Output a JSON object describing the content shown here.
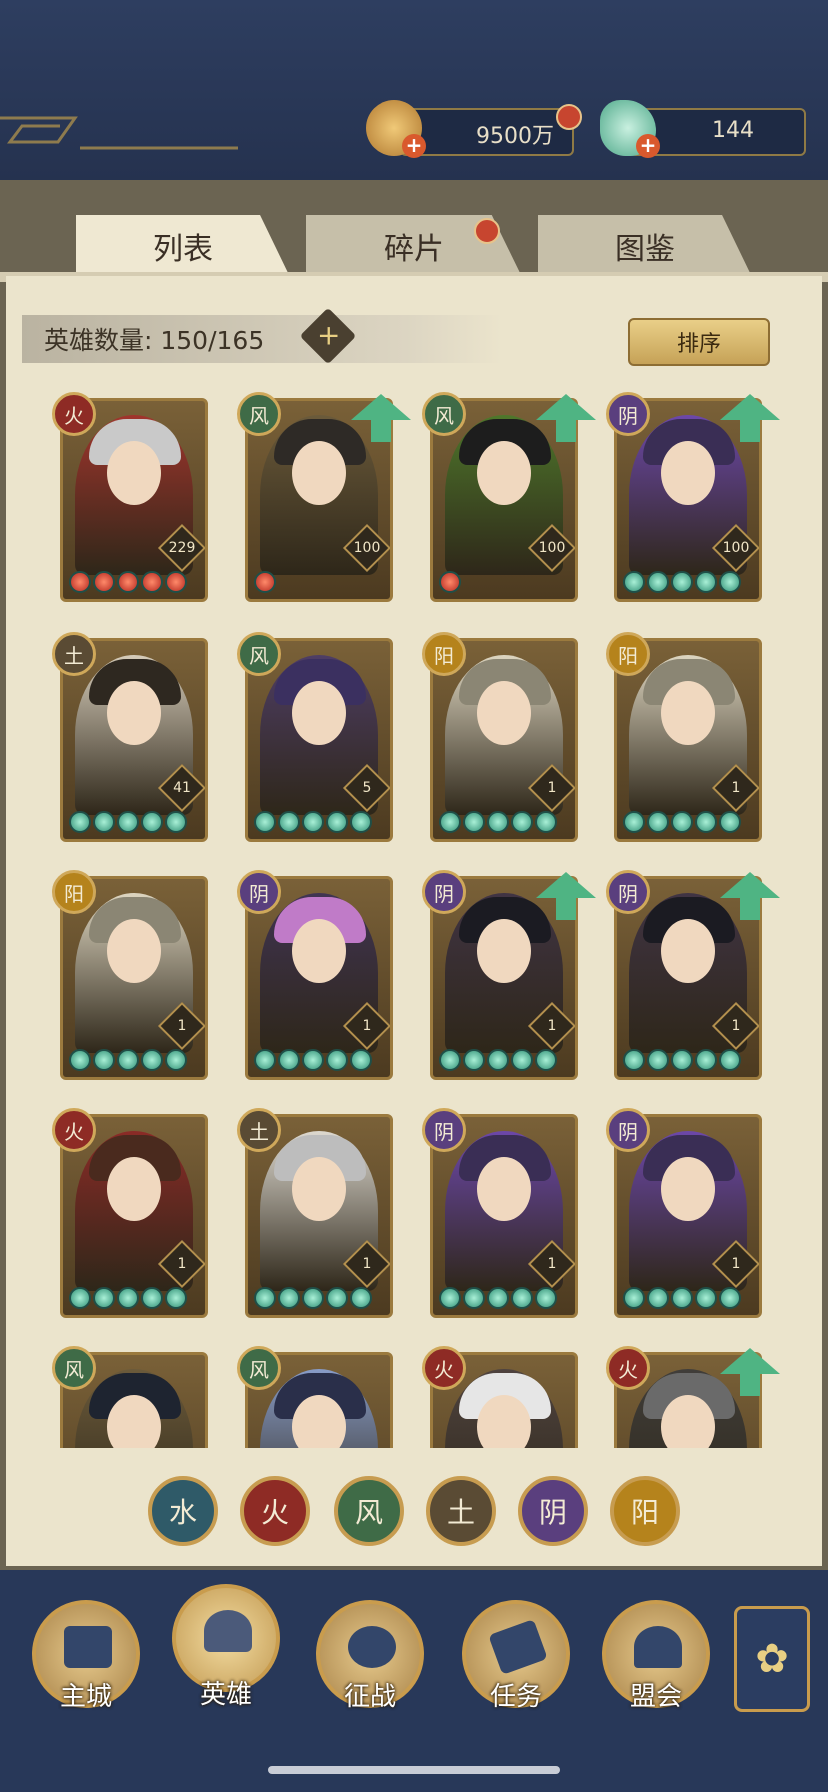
{
  "resources": {
    "copper": {
      "value": "9500万"
    },
    "jade": {
      "value": "144"
    }
  },
  "tabs": [
    {
      "label": "列表"
    },
    {
      "label": "碎片"
    },
    {
      "label": "图鉴"
    }
  ],
  "hero_count": {
    "label": "英雄数量: 150/165"
  },
  "sort_label": "排序",
  "cards": [
    {
      "element": "火",
      "level": "229",
      "stars": 5,
      "upgrade": false,
      "hair": "#c9c9c9",
      "tone": "#a5302b"
    },
    {
      "element": "风",
      "level": "100",
      "stars": 1,
      "upgrade": true,
      "hair": "#2e2a26",
      "tone": "#6a5a3b"
    },
    {
      "element": "风",
      "level": "100",
      "stars": 1,
      "upgrade": true,
      "hair": "#1d1d1d",
      "tone": "#4a7a2a"
    },
    {
      "element": "阴",
      "level": "100",
      "stars": 5,
      "upgrade": true,
      "hair": "#3a2e55",
      "tone": "#6b45b6"
    },
    {
      "element": "土",
      "level": "41",
      "stars": 5,
      "upgrade": false,
      "hair": "#2e2820",
      "tone": "#e0d8c8"
    },
    {
      "element": "风",
      "level": "5",
      "stars": 5,
      "upgrade": false,
      "hair": "#3b3060",
      "tone": "#4a3a6a"
    },
    {
      "element": "阳",
      "level": "1",
      "stars": 5,
      "upgrade": false,
      "hair": "#8b8674",
      "tone": "#e8e2cf"
    },
    {
      "element": "阳",
      "level": "1",
      "stars": 5,
      "upgrade": false,
      "hair": "#8b8674",
      "tone": "#e8e2cf"
    },
    {
      "element": "阳",
      "level": "1",
      "stars": 5,
      "upgrade": false,
      "hair": "#8b8674",
      "tone": "#e8e2cf"
    },
    {
      "element": "阴",
      "level": "1",
      "stars": 5,
      "upgrade": false,
      "hair": "#c07bc8",
      "tone": "#3a2f55"
    },
    {
      "element": "阴",
      "level": "1",
      "stars": 5,
      "upgrade": true,
      "hair": "#1b1b22",
      "tone": "#3a2f45"
    },
    {
      "element": "阴",
      "level": "1",
      "stars": 5,
      "upgrade": true,
      "hair": "#1b1b22",
      "tone": "#3a2f45"
    },
    {
      "element": "火",
      "level": "1",
      "stars": 5,
      "upgrade": false,
      "hair": "#4a2a1e",
      "tone": "#8d2525"
    },
    {
      "element": "土",
      "level": "1",
      "stars": 5,
      "upgrade": false,
      "hair": "#bdbdbd",
      "tone": "#e8e6e0"
    },
    {
      "element": "阴",
      "level": "1",
      "stars": 5,
      "upgrade": false,
      "hair": "#3a2e55",
      "tone": "#6b45b6"
    },
    {
      "element": "阴",
      "level": "1",
      "stars": 5,
      "upgrade": false,
      "hair": "#3a2e55",
      "tone": "#6b45b6"
    },
    {
      "element": "风",
      "level": "",
      "stars": 0,
      "upgrade": false,
      "hair": "#1e2430",
      "tone": "#6a5a3b"
    },
    {
      "element": "风",
      "level": "",
      "stars": 0,
      "upgrade": false,
      "hair": "#2a2f4a",
      "tone": "#8aa3d8"
    },
    {
      "element": "火",
      "level": "",
      "stars": 0,
      "upgrade": false,
      "hair": "#e6e6e6",
      "tone": "#4a4040"
    },
    {
      "element": "火",
      "level": "",
      "stars": 0,
      "upgrade": true,
      "hair": "#6a6a6a",
      "tone": "#3a3a3a"
    }
  ],
  "filters": [
    {
      "glyph": "水",
      "color": "#2f5a68"
    },
    {
      "glyph": "火",
      "color": "#8e2b25"
    },
    {
      "glyph": "风",
      "color": "#3f6b47"
    },
    {
      "glyph": "土",
      "color": "#5a4b34"
    },
    {
      "glyph": "阴",
      "color": "#5a3f7e"
    },
    {
      "glyph": "阳",
      "color": "#b5831c"
    }
  ],
  "nav": [
    {
      "label": "主城",
      "icon": "city-gate-icon"
    },
    {
      "label": "英雄",
      "icon": "hero-portrait-icon"
    },
    {
      "label": "征战",
      "icon": "battle-icon"
    },
    {
      "label": "任务",
      "icon": "scroll-task-icon"
    },
    {
      "label": "盟会",
      "icon": "alliance-gate-icon"
    }
  ],
  "element_colors": {
    "火": "#8e2b25",
    "风": "#3f6b47",
    "阴": "#5a3f7e",
    "阳": "#b5831c",
    "土": "#5a4b34",
    "水": "#2f5a68"
  }
}
